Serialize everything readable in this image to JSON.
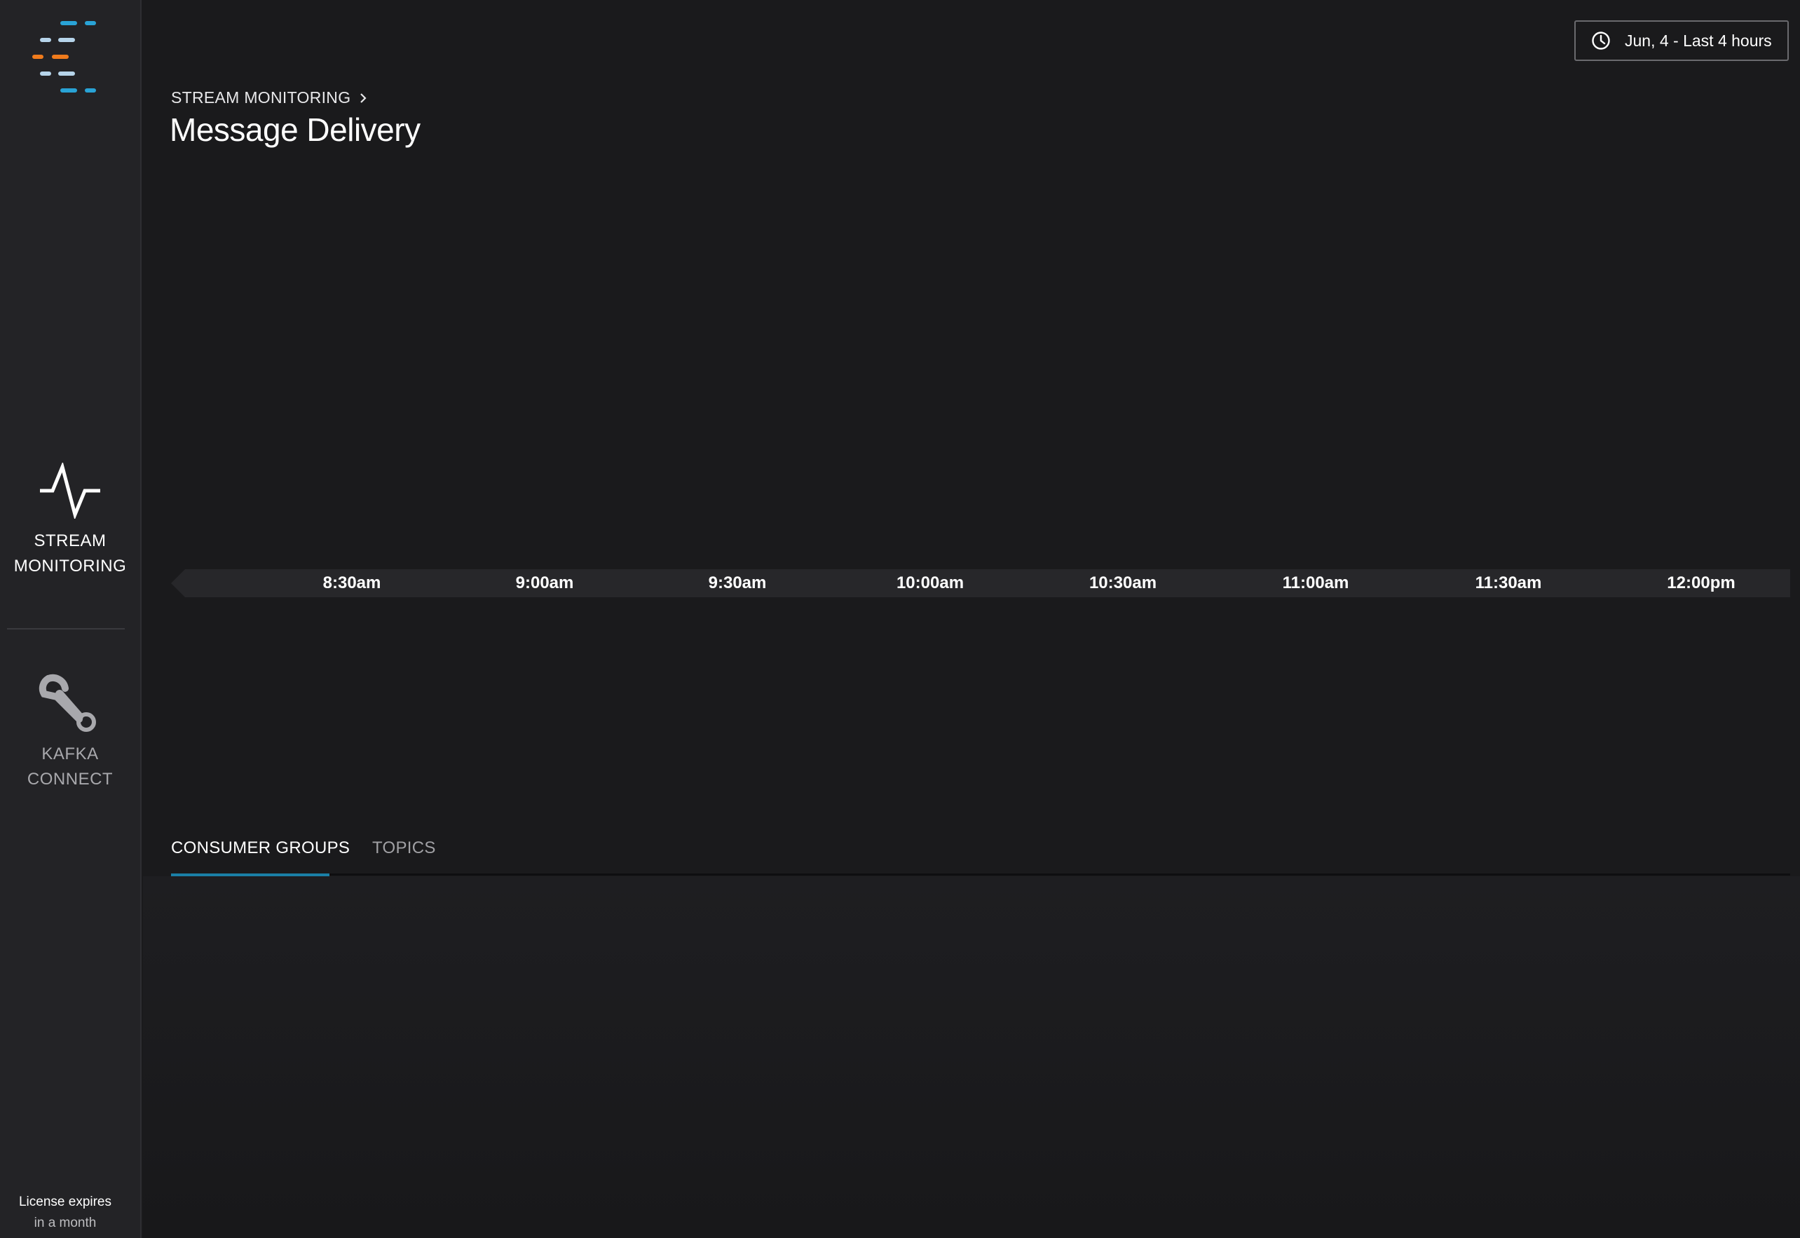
{
  "sidebar": {
    "nav": [
      {
        "label": "STREAM\nMONITORING",
        "icon": "pulse-icon"
      },
      {
        "label": "KAFKA\nCONNECT",
        "icon": "wrench-icon"
      }
    ],
    "license": {
      "line1": "License expires",
      "line2": "in a month"
    }
  },
  "header": {
    "date_range": "Jun, 4 - Last 4 hours",
    "breadcrumb": "STREAM MONITORING",
    "title": "Message Delivery"
  },
  "timeline": {
    "ticks": [
      "8:30am",
      "9:00am",
      "9:30am",
      "10:00am",
      "10:30am",
      "11:00am",
      "11:30am",
      "12:00pm"
    ]
  },
  "tabs": {
    "items": [
      "CONSUMER GROUPS",
      "TOPICS"
    ],
    "selected": "CONSUMER GROUPS"
  },
  "colors": {
    "accent": "#1a7fa6",
    "logo_blue": "#29a3d6",
    "logo_light": "#b6d4ea",
    "logo_orange": "#f07b1c",
    "background": "#1a1a1c",
    "sidebar": "#232326"
  }
}
